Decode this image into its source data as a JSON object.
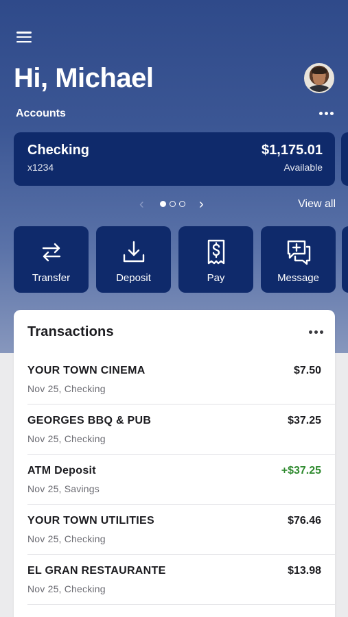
{
  "header": {
    "greeting": "Hi, Michael",
    "menu_icon": "hamburger-menu-icon",
    "avatar_icon": "user-avatar"
  },
  "accounts": {
    "label": "Accounts",
    "more_icon": "more-horizontal-icon",
    "card": {
      "name": "Checking",
      "number": "x1234",
      "balance": "$1,175.01",
      "balance_label": "Available"
    },
    "pager": {
      "total": 3,
      "active": 1
    },
    "view_all": "View all"
  },
  "actions": [
    {
      "label": "Transfer",
      "icon": "transfer-arrows-icon"
    },
    {
      "label": "Deposit",
      "icon": "download-tray-icon"
    },
    {
      "label": "Pay",
      "icon": "dollar-receipt-icon"
    },
    {
      "label": "Message",
      "icon": "message-plus-icon"
    }
  ],
  "transactions": {
    "title": "Transactions",
    "items": [
      {
        "name": "YOUR TOWN CINEMA",
        "meta": "Nov 25, Checking",
        "amount": "$7.50"
      },
      {
        "name": "GEORGES BBQ & PUB",
        "meta": "Nov 25, Checking",
        "amount": "$37.25"
      },
      {
        "name": "ATM Deposit",
        "meta": "Nov 25, Savings",
        "amount": "+$37.25"
      },
      {
        "name": "YOUR TOWN UTILITIES",
        "meta": "Nov 25, Checking",
        "amount": "$76.46"
      },
      {
        "name": "EL GRAN RESTAURANTE",
        "meta": "Nov 25, Checking",
        "amount": "$13.98"
      }
    ]
  },
  "colors": {
    "brand_navy": "#0f2a6b",
    "hero_blue": "#3b5694",
    "positive_green": "#2f8a2f"
  }
}
